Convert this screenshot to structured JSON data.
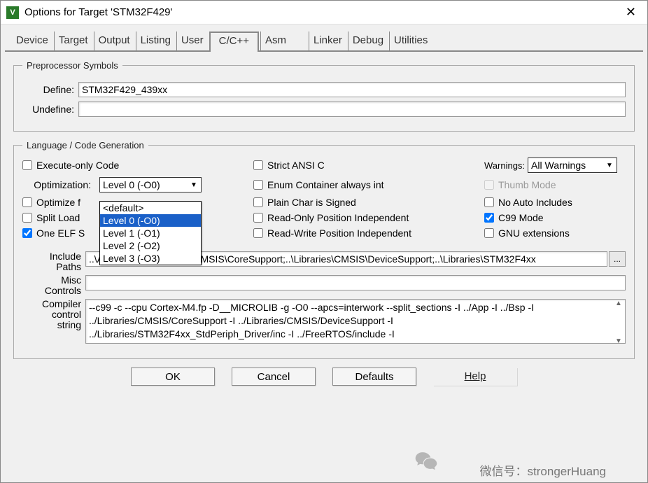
{
  "window": {
    "title": "Options for Target 'STM32F429'"
  },
  "tabs": [
    "Device",
    "Target",
    "Output",
    "Listing",
    "User",
    "C/C++",
    "Asm",
    "Linker",
    "Debug",
    "Utilities"
  ],
  "active_tab": "C/C++",
  "preprocessor": {
    "group_label": "Preprocessor Symbols",
    "define_label": "Define:",
    "define_value": "STM32F429_439xx",
    "undefine_label": "Undefine:",
    "undefine_value": ""
  },
  "lang": {
    "group_label": "Language / Code Generation",
    "execute_only": "Execute-only Code",
    "strict_ansi": "Strict ANSI C",
    "warnings_label": "Warnings:",
    "warnings_value": "All Warnings",
    "optimization_label": "Optimization:",
    "optimization_value": "Level 0 (-O0)",
    "optimization_options": [
      "<default>",
      "Level 0 (-O0)",
      "Level 1 (-O1)",
      "Level 2 (-O2)",
      "Level 3 (-O3)"
    ],
    "optimization_selected_index": 1,
    "enum_always_int": "Enum Container always int",
    "thumb_mode": "Thumb Mode",
    "optimize_for": "Optimize f",
    "plain_char": "Plain Char is Signed",
    "no_auto_includes": "No Auto Includes",
    "split_load": "Split Load",
    "ro_pos_indep": "Read-Only Position Independent",
    "c99_mode": "C99 Mode",
    "one_elf": "One ELF S",
    "rw_pos_indep": "Read-Write Position Independent",
    "gnu_ext": "GNU extensions",
    "c99_checked": true,
    "one_elf_checked": true
  },
  "paths": {
    "include_label": "Include\nPaths",
    "include_value": "..\\App;..\\Bsp;..\\Libraries\\CMSIS\\CoreSupport;..\\Libraries\\CMSIS\\DeviceSupport;..\\Libraries\\STM32F4xx",
    "misc_label": "Misc\nControls",
    "misc_value": "",
    "ccs_label": "Compiler\ncontrol\nstring",
    "ccs_value": "--c99 -c --cpu Cortex-M4.fp -D__MICROLIB -g -O0 --apcs=interwork --split_sections -I ../App -I ../Bsp -I\n../Libraries/CMSIS/CoreSupport -I ../Libraries/CMSIS/DeviceSupport -I\n../Libraries/STM32F4xx_StdPeriph_Driver/inc -I ../FreeRTOS/include -I"
  },
  "buttons": {
    "ok": "OK",
    "cancel": "Cancel",
    "defaults": "Defaults",
    "help": "Help"
  },
  "watermark": "微信号：strongerHuang"
}
